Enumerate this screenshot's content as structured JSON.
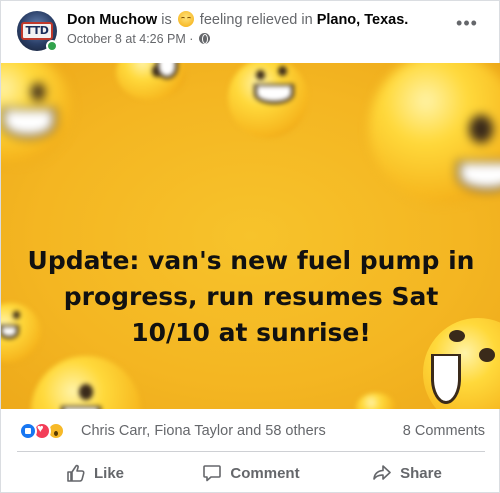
{
  "header": {
    "user_name": "Don Muchow",
    "is_text": "is",
    "feeling_text": "feeling relieved in",
    "location": "Plano, Texas.",
    "timestamp": "October 8 at 4:26 PM",
    "separator": "·",
    "avatar_logo_text": "TTD",
    "feeling_icon": "relieved-face-icon",
    "audience_icon": "globe-icon",
    "more_icon": "more-options-icon"
  },
  "photo": {
    "caption": "Update: van's new fuel pump in progress, run resumes Sat 10/10 at sunrise!",
    "background_color": "#f4b622"
  },
  "reactions": {
    "icons": [
      "like-reaction-icon",
      "love-reaction-icon",
      "wow-reaction-icon"
    ],
    "names_text": "Chris Carr, Fiona Taylor and 58 others",
    "comments_text": "8 Comments"
  },
  "actions": {
    "like_label": "Like",
    "comment_label": "Comment",
    "share_label": "Share"
  },
  "colors": {
    "muted_text": "#65676b",
    "like_blue": "#1877f2",
    "love_red": "#f33e58",
    "wow_yellow": "#f7b928",
    "online_green": "#31a24c"
  }
}
